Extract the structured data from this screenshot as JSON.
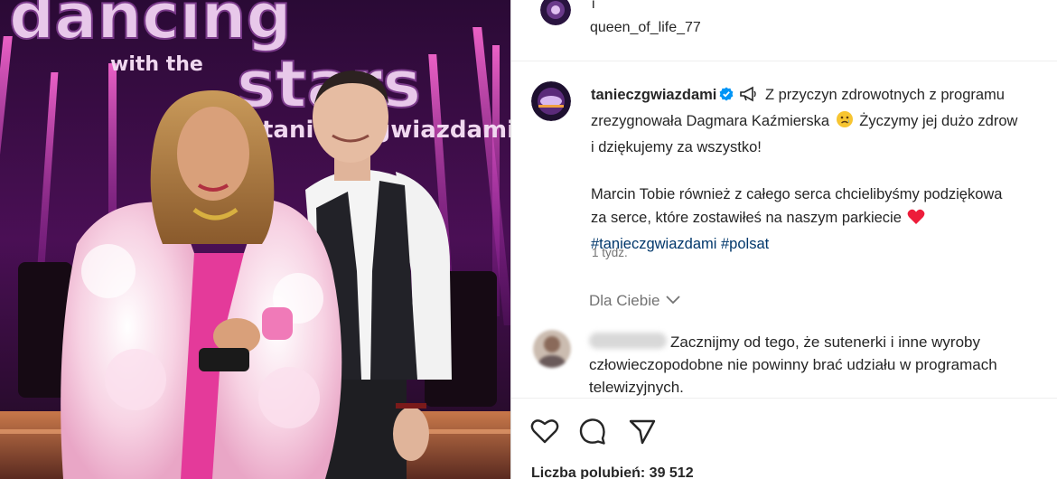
{
  "photo": {
    "logo_line1": "dancing",
    "logo_line2_small": "with the",
    "logo_line2_big": "stars",
    "logo_line3": "taniec z gwiazdami"
  },
  "top_comment": {
    "text_fragment": "i",
    "username": "queen_of_life_77"
  },
  "caption": {
    "username": "tanieczgwiazdami",
    "line1": "Z przyczyn zdrowotnych z programu",
    "line2": "zrezygnowała Dagmara Kaźmierska",
    "line2b": "Życzymy jej dużo zdrow",
    "line3": "i dziękujemy za wszystko!",
    "line4": "Marcin Tobie również z całego serca chcielibyśmy podziękowa",
    "line5": "za serce, które zostawiłeś na naszym parkiecie",
    "hashtag1": "#tanieczgwiazdami",
    "hashtag2": "#polsat",
    "time": "1 tydz."
  },
  "filter": {
    "label": "Dla Ciebie"
  },
  "comment": {
    "username_hidden": "cartling",
    "line1": "Zacznijmy od tego, że sutenerki i inne wyroby",
    "line2": "człowieczopodobne nie powinny brać udziału w programach",
    "line3": "telewizyjnych."
  },
  "stats": {
    "likes": "Liczba polubień: 39 512"
  },
  "icons": {
    "like": "heart-icon",
    "comment": "comment-icon",
    "share": "share-icon",
    "verified": "verified-badge-icon",
    "megaphone": "megaphone-icon",
    "sad": "sad-face-emoji",
    "heart": "red-heart-emoji",
    "chevron": "chevron-down-icon"
  },
  "colors": {
    "link": "#00376b",
    "verified": "#0095f6",
    "muted": "#737373",
    "text": "#262626",
    "heart": "#ed1c3a"
  }
}
